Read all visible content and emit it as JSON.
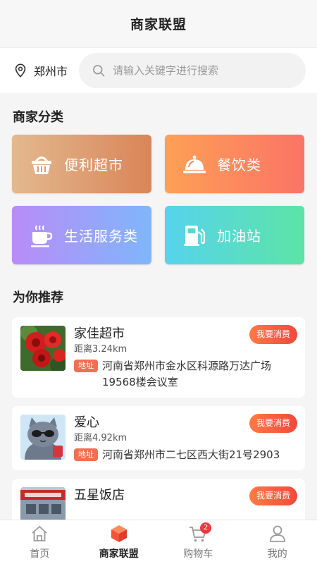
{
  "header": {
    "title": "商家联盟"
  },
  "location": {
    "city": "郑州市"
  },
  "search": {
    "placeholder": "请输入关键字进行搜索"
  },
  "categories_section": {
    "title": "商家分类"
  },
  "categories": [
    {
      "label": "便利超市",
      "icon": "basket-icon"
    },
    {
      "label": "餐饮类",
      "icon": "food-cover-icon"
    },
    {
      "label": "生活服务类",
      "icon": "coffee-cup-icon"
    },
    {
      "label": "加油站",
      "icon": "gas-pump-icon"
    }
  ],
  "recommend_section": {
    "title": "为你推荐"
  },
  "shops": [
    {
      "name": "家佳超市",
      "distance": "距离3.24km",
      "tag": "地址",
      "address": "河南省郑州市金水区科源路万达广场19568楼会议室",
      "action": "我要消费"
    },
    {
      "name": "爱心",
      "distance": "距离4.92km",
      "tag": "地址",
      "address": "河南省郑州市二七区西大街21号2903",
      "action": "我要消费"
    },
    {
      "name": "五星饭店",
      "distance": "",
      "tag": "",
      "address": "",
      "action": "我要消费"
    }
  ],
  "tabbar": {
    "items": [
      {
        "label": "首页",
        "icon": "home-icon"
      },
      {
        "label": "商家联盟",
        "icon": "cube-icon",
        "active": true
      },
      {
        "label": "购物车",
        "icon": "cart-icon",
        "badge": "2"
      },
      {
        "label": "我的",
        "icon": "user-icon"
      }
    ]
  },
  "colors": {
    "accent": "#f5483b",
    "tag": "#f07052"
  }
}
